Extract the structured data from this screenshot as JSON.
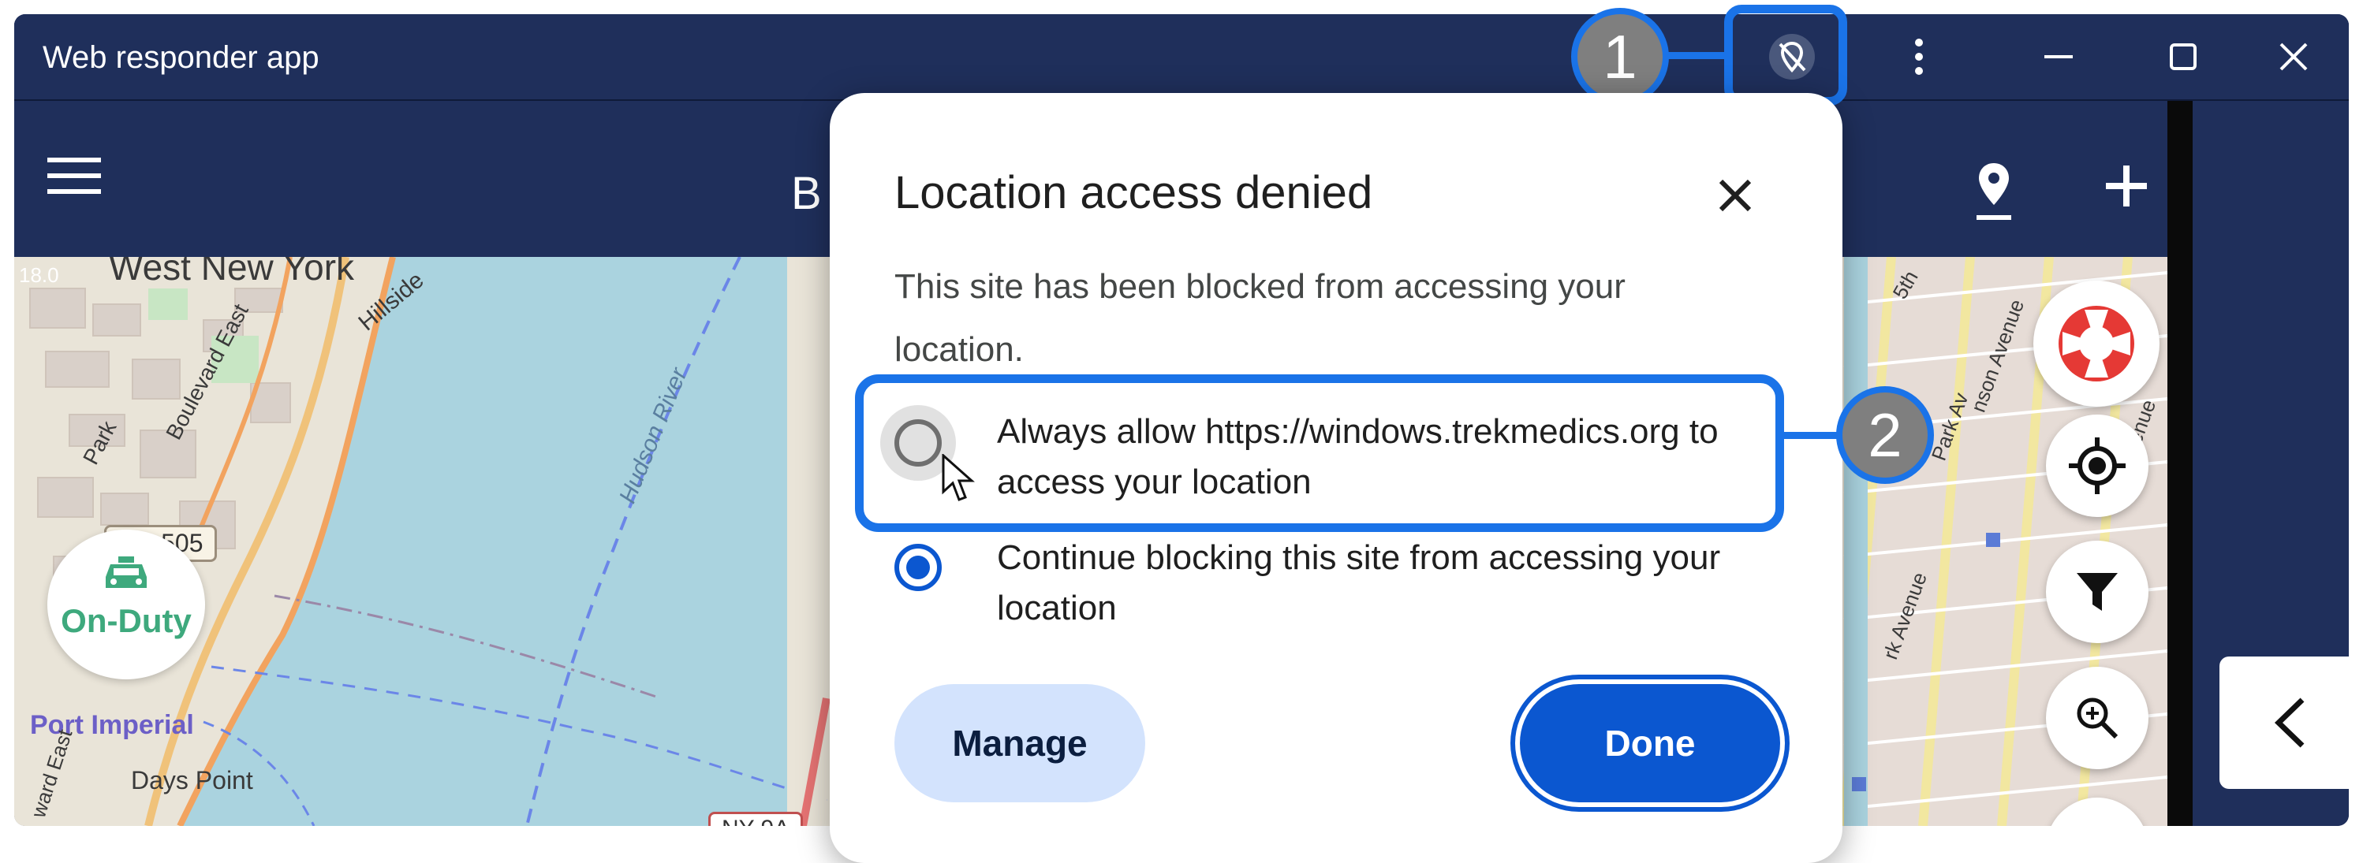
{
  "window": {
    "title": "Web responder app",
    "controls": {
      "menu": "⋮",
      "minimize": "—",
      "maximize": "☐",
      "close": "✕"
    }
  },
  "appbar": {
    "title_partial": "B"
  },
  "map": {
    "badge": "On-Duty",
    "zoom_readout": "18.0",
    "labels": {
      "west_new_york": "West New York",
      "hillside": "Hillside",
      "boulevard_east": "Boulevard East",
      "park": "Park",
      "hudson_river": "Hudson River",
      "port_imperial": "Port Imperial",
      "days_point": "Days Point",
      "ward_east": "ward East",
      "nth": "5th",
      "nson_avenue": "nson Avenue",
      "park_av": "Park Av",
      "venue": "venue",
      "rk_avenue": "rk Avenue"
    },
    "shields": {
      "cr505": "CR 505",
      "ny9a": "NY 9A"
    }
  },
  "dialog": {
    "title": "Location access denied",
    "description": "This site has been blocked from accessing your location.",
    "options": [
      {
        "label": "Always allow https://windows.trekmedics.org to access your location",
        "selected": false
      },
      {
        "label": "Continue blocking this site from accessing your location",
        "selected": true
      }
    ],
    "manage_label": "Manage",
    "done_label": "Done"
  },
  "annotations": {
    "callout1": "1",
    "callout2": "2"
  },
  "colors": {
    "accent": "#1a73e8",
    "titlebar": "#1f2f5b",
    "primary_button": "#0b57d0",
    "tonal_button": "#d3e3fd",
    "water": "#aad3df",
    "on_duty": "#3ea97d"
  },
  "icons": {
    "location_blocked": "location-off-icon",
    "hamburger": "hamburger-menu-icon",
    "map_pin": "map-pin-icon",
    "add": "plus-icon",
    "lifebuoy": "lifebuoy-icon",
    "locate": "crosshair-icon",
    "filter": "filter-icon",
    "zoom": "zoom-in-icon",
    "collapse": "chevron-left-icon",
    "taxi": "taxi-icon"
  }
}
